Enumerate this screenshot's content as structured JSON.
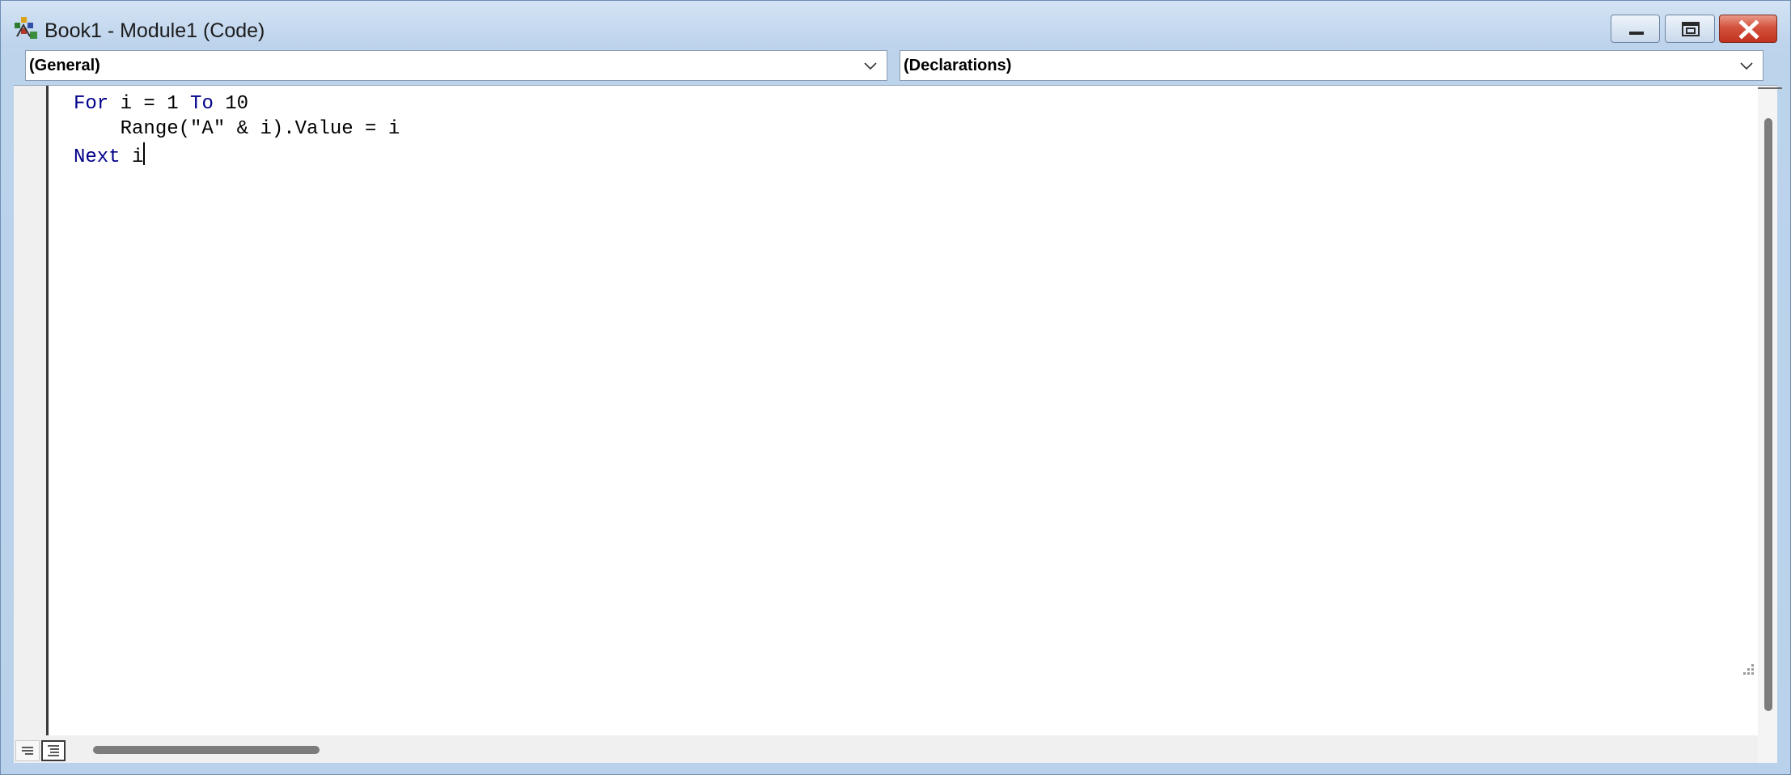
{
  "window": {
    "title": "Book1 - Module1 (Code)",
    "icon": "vba-module-icon",
    "buttons": [
      "minimize",
      "maximize",
      "close"
    ]
  },
  "object_combo": {
    "selected": "(General)"
  },
  "procedure_combo": {
    "selected": "(Declarations)"
  },
  "code": {
    "line1": {
      "kw1": "For",
      "t1": " i = 1 ",
      "kw2": "To",
      "t2": " 10"
    },
    "line2": {
      "text": "    Range(\"A\" & i).Value = i"
    },
    "line3": {
      "kw1": "Next",
      "t1": " i"
    }
  },
  "colors": {
    "keyword": "#00008b",
    "title_bar": "#bdd3ec",
    "close_button": "#c2331f"
  }
}
